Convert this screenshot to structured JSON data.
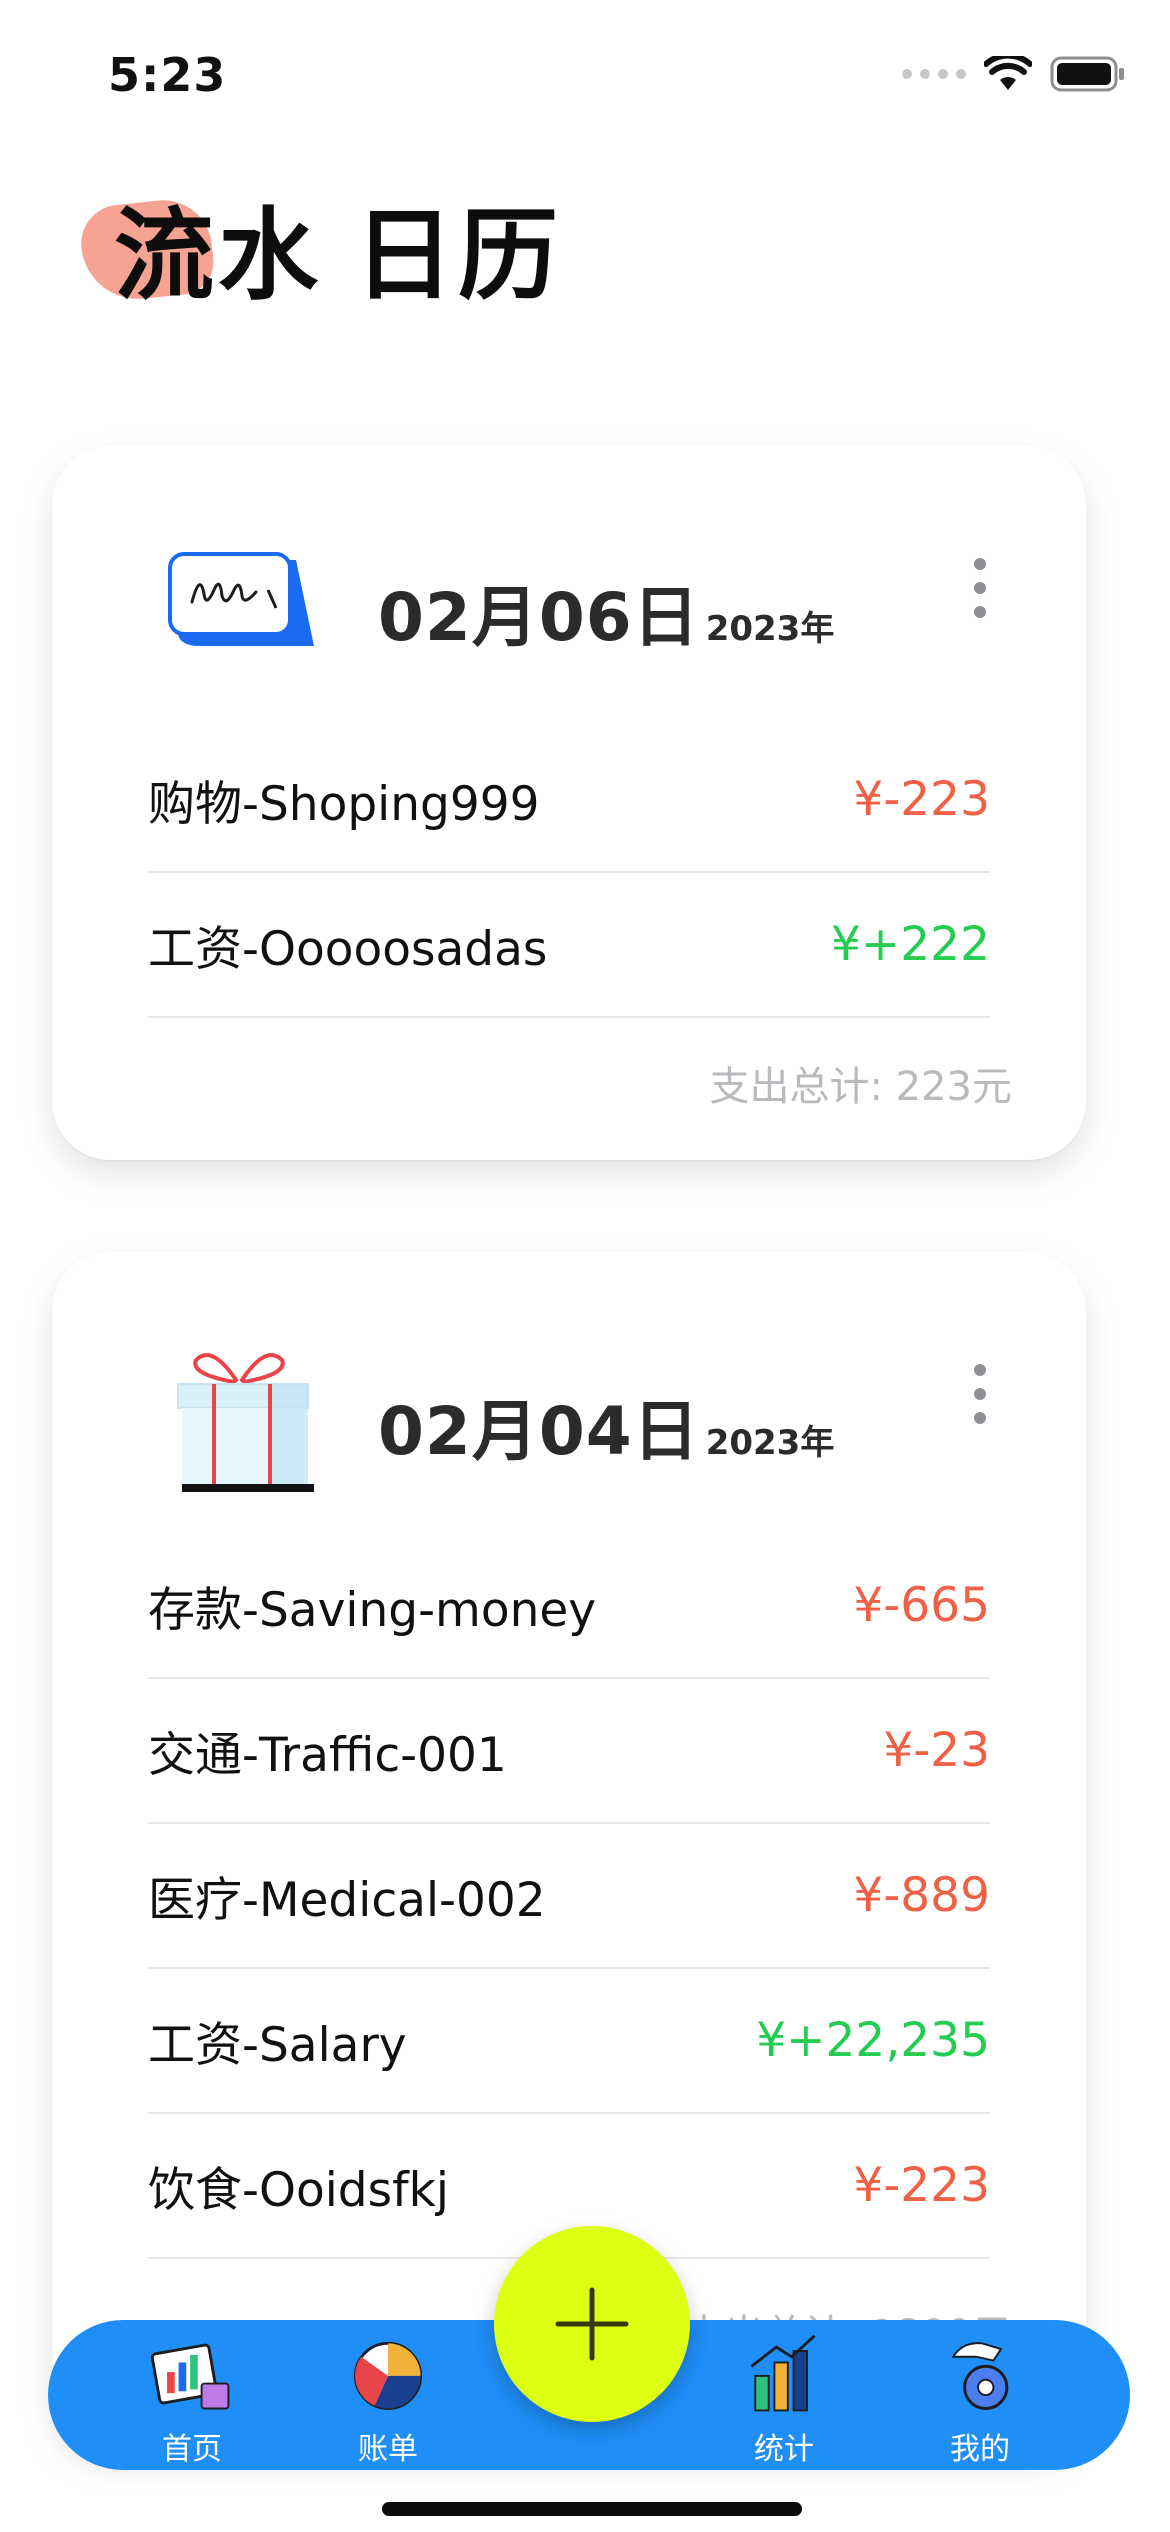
{
  "status_bar": {
    "time": "5:23"
  },
  "header": {
    "tabs": [
      {
        "label": "流水",
        "active": true
      },
      {
        "label": "日历",
        "active": false
      }
    ]
  },
  "days": [
    {
      "icon": "signature-card-icon",
      "date": "02月06日",
      "year": "2023年",
      "items": [
        {
          "label": "购物-Shoping999",
          "amount": "¥-223",
          "type": "expense"
        },
        {
          "label": "工资-Ooooosadas",
          "amount": "¥+222",
          "type": "income"
        }
      ],
      "total": "支出总计: 223元"
    },
    {
      "icon": "gift-box-icon",
      "date": "02月04日",
      "year": "2023年",
      "items": [
        {
          "label": "存款-Saving-money",
          "amount": "¥-665",
          "type": "expense"
        },
        {
          "label": "交通-Traffic-001",
          "amount": "¥-23",
          "type": "expense"
        },
        {
          "label": "医疗-Medical-002",
          "amount": "¥-889",
          "type": "expense"
        },
        {
          "label": "工资-Salary",
          "amount": "¥+22,235",
          "type": "income"
        },
        {
          "label": "饮食-Ooidsfkj",
          "amount": "¥-223",
          "type": "expense"
        }
      ],
      "total": "支出总计: 1800元"
    }
  ],
  "tab_bar": {
    "items": [
      {
        "label": "首页",
        "icon": "home-chart-icon"
      },
      {
        "label": "账单",
        "icon": "bill-pie-icon"
      },
      {
        "label": "统计",
        "icon": "stats-bar-icon"
      },
      {
        "label": "我的",
        "icon": "profile-gear-icon"
      }
    ],
    "fab_icon": "plus-icon"
  },
  "colors": {
    "accent": "#1f8ef7",
    "fab": "#dcff12",
    "expense": "#ef6147",
    "income": "#25cc52",
    "highlight": "#f7a394"
  }
}
